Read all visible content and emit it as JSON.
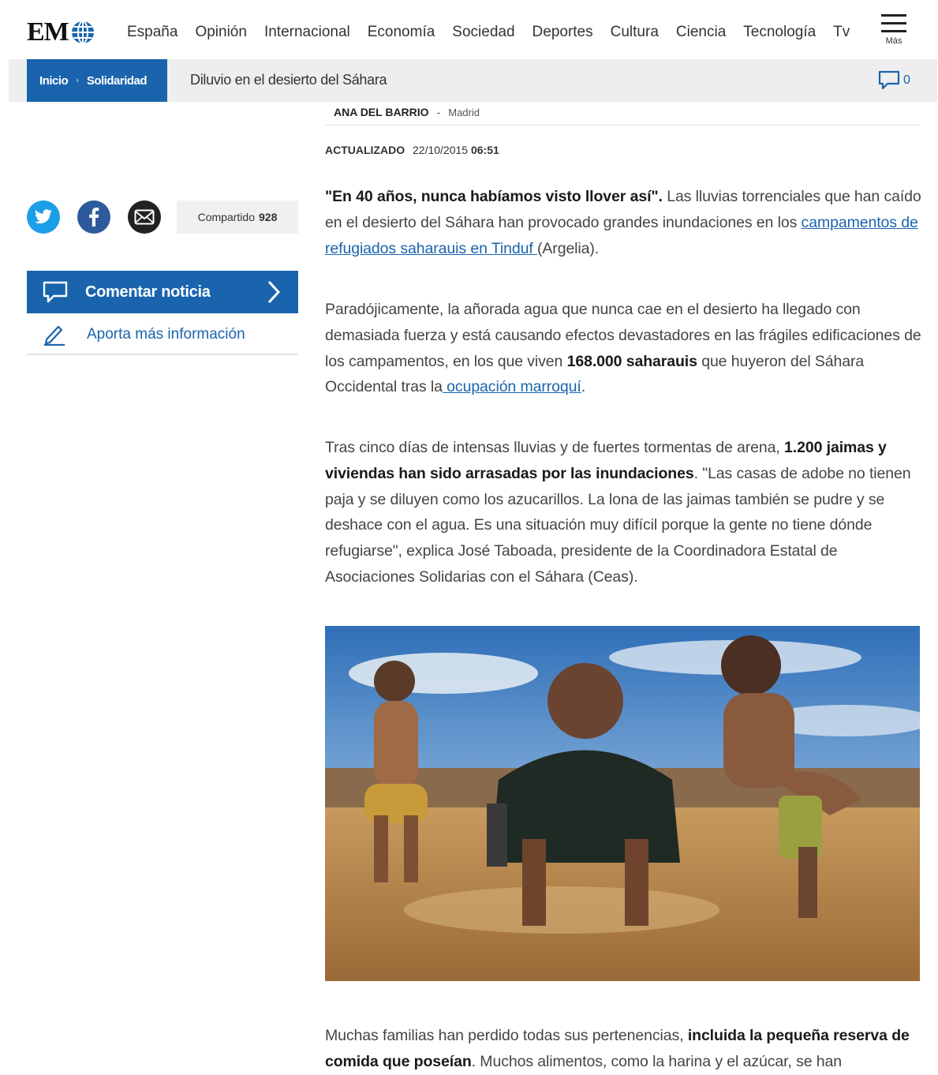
{
  "header": {
    "logo_text": "EM",
    "nav": [
      "España",
      "Opinión",
      "Internacional",
      "Economía",
      "Sociedad",
      "Deportes",
      "Cultura",
      "Ciencia",
      "Tecnología",
      "Tv"
    ],
    "menu_label": "Más"
  },
  "breadcrumb": {
    "items": [
      "Inicio",
      "Solidaridad"
    ],
    "separator": "›",
    "title": "Diluvio en el desierto del Sáhara",
    "comment_count": "0"
  },
  "sidebar": {
    "share_label": "Compartido",
    "share_count": "928",
    "comment_button": "Comentar noticia",
    "contribute_link": "Aporta más información"
  },
  "article": {
    "author": "ANA DEL BARRIO",
    "byline_separator": "-",
    "location": "Madrid",
    "updated_label": "ACTUALIZADO",
    "updated_date": "22/10/2015",
    "updated_time": "06:51",
    "p1": {
      "bold": "\"En 40 años, nunca habíamos visto llover así\".",
      "text": " Las lluvias torrenciales que han caído en el desierto del Sáhara han provocado grandes inundaciones en los ",
      "link": "campamentos de refugiados saharauis en Tinduf ",
      "tail": "(Argelia)."
    },
    "p2": {
      "text": "Paradójicamente, la añorada agua que nunca cae en el desierto ha llegado con demasiada fuerza y está causando efectos devastadores en las frágiles edificaciones de los campamentos, en los que viven ",
      "bold": "168.000 saharauis",
      "text2": " que huyeron del Sáhara Occidental tras la",
      "link": " ocupación marroquí",
      "tail": "."
    },
    "p3": {
      "text": "Tras cinco días de intensas lluvias y de fuertes tormentas de arena, ",
      "bold": "1.200 jaimas y viviendas han sido arrasadas por las inundaciones",
      "text2": ". \"Las casas de adobe no tienen paja y se diluyen como los azucarillos. La lona de las jaimas también se pudre y se deshace con el agua. Es una situación muy difícil porque la gente no tiene dónde refugiarse\", explica José Taboada, presidente de la Coordinadora Estatal de Asociaciones Solidarias con el Sáhara (Ceas)."
    },
    "p4": {
      "text": "Muchas familias han perdido todas sus pertenencias, ",
      "bold": "incluida la pequeña reserva de comida que poseían",
      "text2": ". Muchos alimentos, como la harina y el azúcar, se han"
    }
  },
  "colors": {
    "brand_blue": "#1a64ad",
    "twitter": "#1d9ee8",
    "facebook": "#2d5a9c",
    "email": "#222222"
  },
  "icons": {
    "logo": "globe-icon",
    "menu": "hamburger-icon",
    "comments": "speech-bubble-icon",
    "twitter": "twitter-bird-icon",
    "facebook": "facebook-f-icon",
    "email": "envelope-icon",
    "chevron": "chevron-right-icon",
    "contribute": "pencil-icon"
  }
}
